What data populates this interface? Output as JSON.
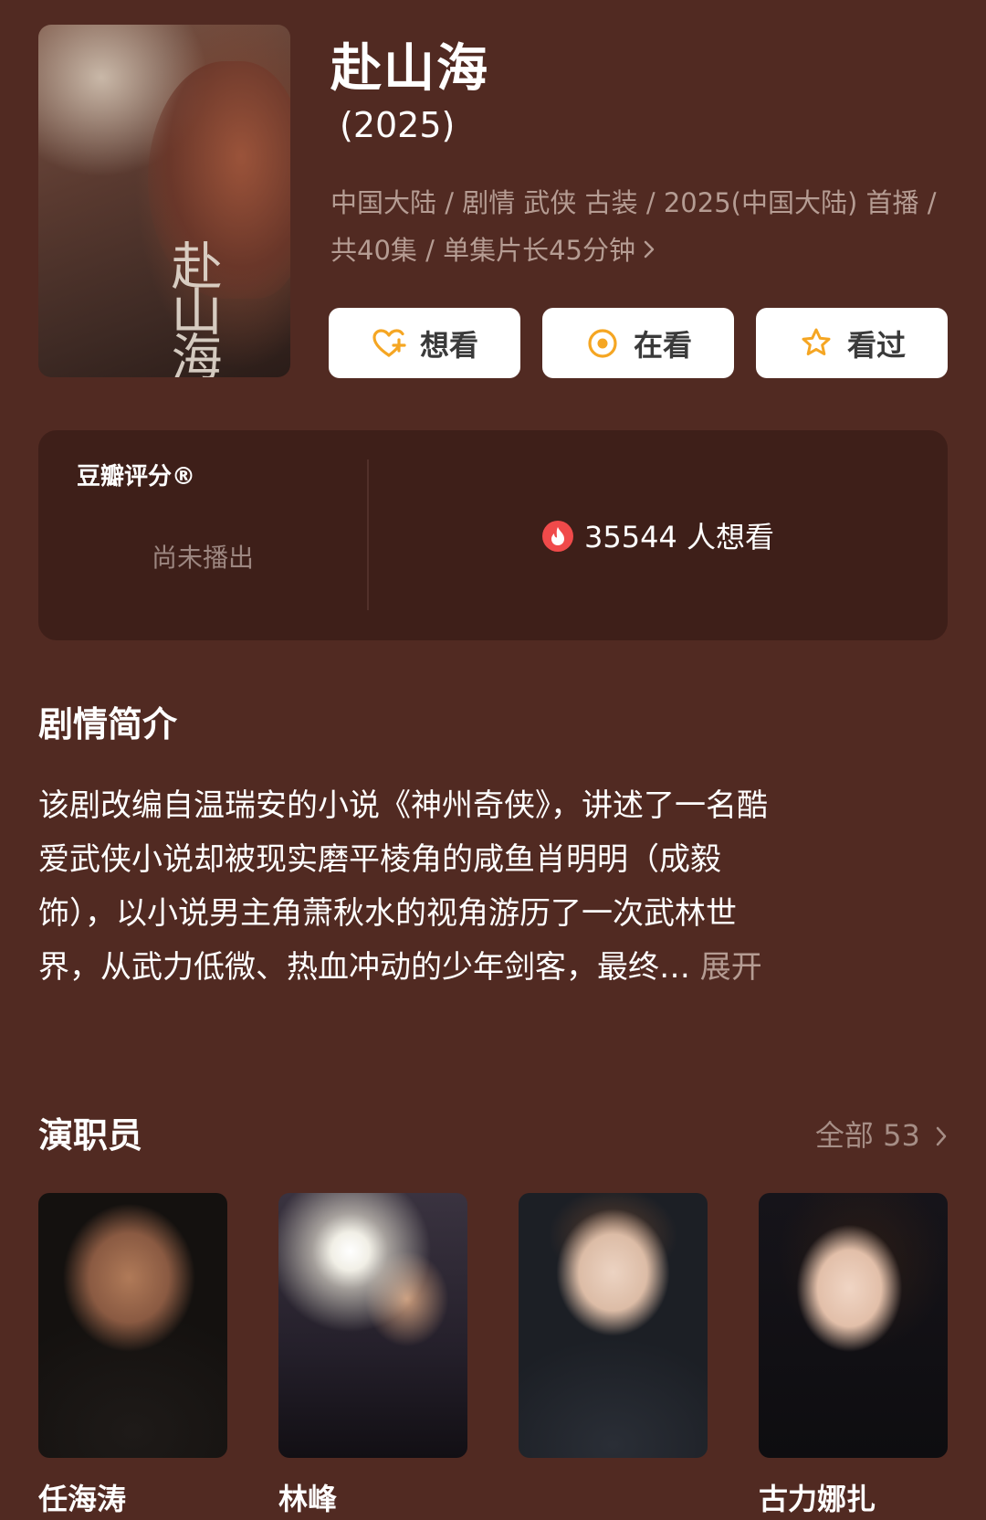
{
  "show": {
    "title": "赴山海",
    "year": "(2025)",
    "meta_line1": "中国大陆 / 剧情 武侠 古装 / 2025(中国大陆) 首播 /",
    "meta_line2": "共40集 / 单集片长45分钟"
  },
  "poster": {
    "calligraphy": "赴山海"
  },
  "actions": [
    {
      "label": "想看",
      "icon": "heart-plus-icon"
    },
    {
      "label": "在看",
      "icon": "target-circle-icon"
    },
    {
      "label": "看过",
      "icon": "star-icon"
    }
  ],
  "rating": {
    "label": "豆瓣评分®",
    "status": "尚未播出",
    "want_count": "35544 人想看"
  },
  "synopsis": {
    "heading": "剧情简介",
    "line1": "该剧改编自温瑞安的小说《神州奇侠》，讲述了一名酷",
    "line2": "爱武侠小说却被现实磨平棱角的咸鱼肖明明（成毅",
    "line3": "饰），以小说男主角萧秋水的视角游历了一次武林世",
    "line4": "界，从武力低微、热血冲动的少年剑客，最终…",
    "more": " 展开"
  },
  "cast": {
    "heading": "演职员",
    "all_label": "全部 53",
    "members": [
      {
        "name": "任海涛"
      },
      {
        "name": "林峰"
      },
      {
        "name": ""
      },
      {
        "name": "古力娜扎"
      }
    ]
  },
  "colors": {
    "background": "#512a22",
    "card": "#3e1f19",
    "accent": "#f5a623",
    "flame": "#f04a4a"
  }
}
